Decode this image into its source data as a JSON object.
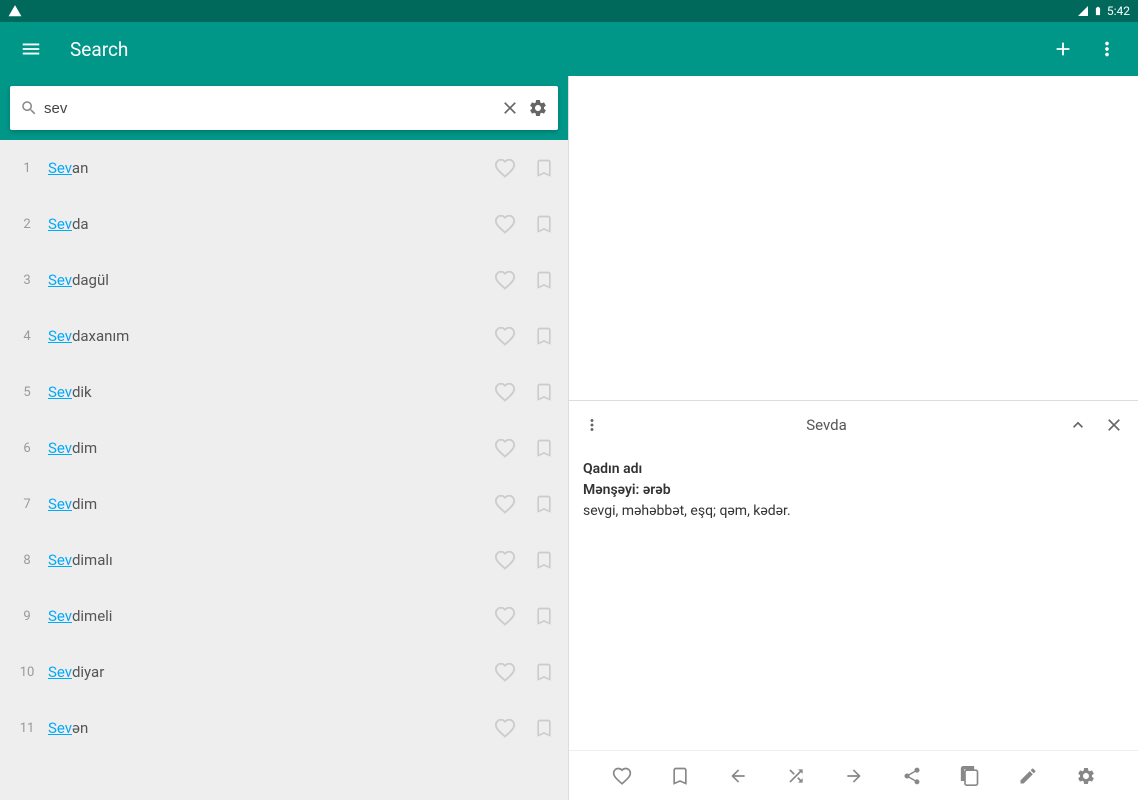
{
  "status": {
    "time": "5:42"
  },
  "appbar": {
    "title": "Search"
  },
  "search": {
    "value": "sev"
  },
  "results": [
    {
      "num": "1",
      "hl": "Sev",
      "rest": "an"
    },
    {
      "num": "2",
      "hl": "Sev",
      "rest": "da"
    },
    {
      "num": "3",
      "hl": "Sev",
      "rest": "dagül"
    },
    {
      "num": "4",
      "hl": "Sev",
      "rest": "daxanım"
    },
    {
      "num": "5",
      "hl": "Sev",
      "rest": "dik"
    },
    {
      "num": "6",
      "hl": "Sev",
      "rest": "dim"
    },
    {
      "num": "7",
      "hl": "Sev",
      "rest": "dim"
    },
    {
      "num": "8",
      "hl": "Sev",
      "rest": "dimalı"
    },
    {
      "num": "9",
      "hl": "Sev",
      "rest": "dimeli"
    },
    {
      "num": "10",
      "hl": "Sev",
      "rest": "diyar"
    },
    {
      "num": "11",
      "hl": "Sev",
      "rest": "ən"
    }
  ],
  "detail": {
    "title": "Sevda",
    "line1": "Qadın adı",
    "line2_label": "Mənşəyi:",
    "line2_value": "ərəb",
    "line3": "sevgi, məhəbbət, eşq; qəm, kədər."
  }
}
